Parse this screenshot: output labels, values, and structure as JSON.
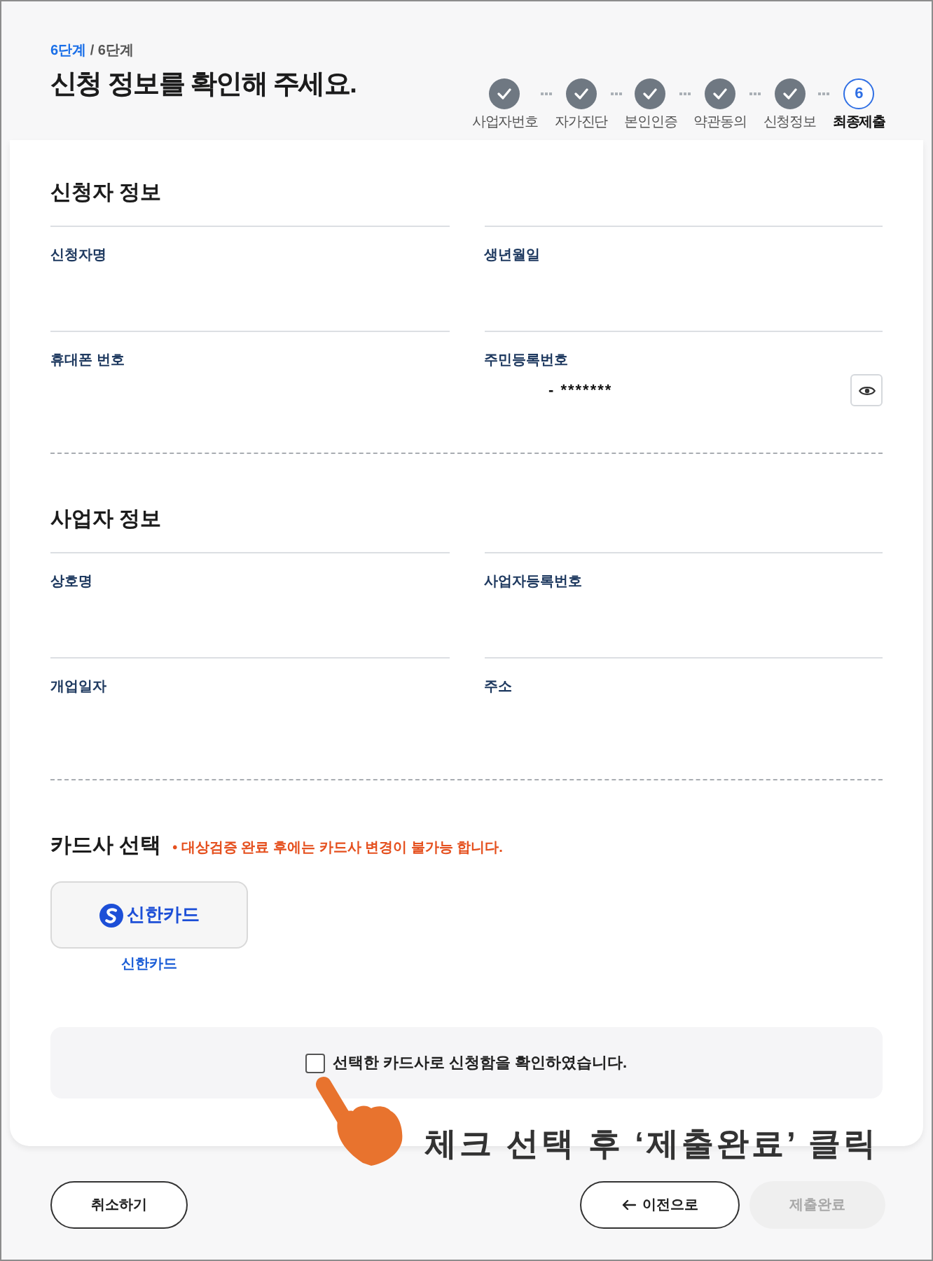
{
  "header": {
    "step_current": "6단계",
    "step_total": "/ 6단계",
    "title": "신청 정보를 확인해 주세요."
  },
  "stepper": {
    "steps": [
      {
        "label": "사업자번호",
        "done": true,
        "selected": false
      },
      {
        "label": "자가진단",
        "done": true,
        "selected": false
      },
      {
        "label": "본인인증",
        "done": true,
        "selected": false
      },
      {
        "label": "약관동의",
        "done": true,
        "selected": false
      },
      {
        "label": "신청정보",
        "done": true,
        "selected": false
      },
      {
        "label": "최종제출",
        "number": "6",
        "done": false,
        "selected": true
      }
    ]
  },
  "sections": [
    {
      "title": "신청자 정보",
      "fields": [
        {
          "label": "신청자명"
        },
        {
          "label": "생년월일"
        },
        {
          "label": "휴대폰 번호"
        },
        {
          "label": "주민등록번호",
          "value": "- *******",
          "masked": true
        }
      ]
    },
    {
      "title": "사업자 정보",
      "fields": [
        {
          "label": "상호명"
        },
        {
          "label": "사업자등록번호"
        },
        {
          "label": "개업일자"
        },
        {
          "label": "주소"
        }
      ]
    }
  ],
  "card_select": {
    "title": "카드사 선택",
    "notice": "• 대상검증 완료 후에는 카드사 변경이 불가능 합니다.",
    "cards": [
      {
        "logo_text": "신한카드",
        "name": "신한카드"
      }
    ]
  },
  "confirm": {
    "label": "선택한 카드사로 신청함을 확인하였습니다.",
    "checked": false
  },
  "buttons": [
    {
      "label": "취소하기",
      "kind": "cancel",
      "disabled": false
    },
    {
      "label": "이전으로",
      "kind": "back",
      "disabled": false
    },
    {
      "label": "제출완료",
      "kind": "submit",
      "disabled": true
    }
  ],
  "annotation": {
    "caption": "체크 선택 후 ‘제출완료’ 클릭"
  }
}
